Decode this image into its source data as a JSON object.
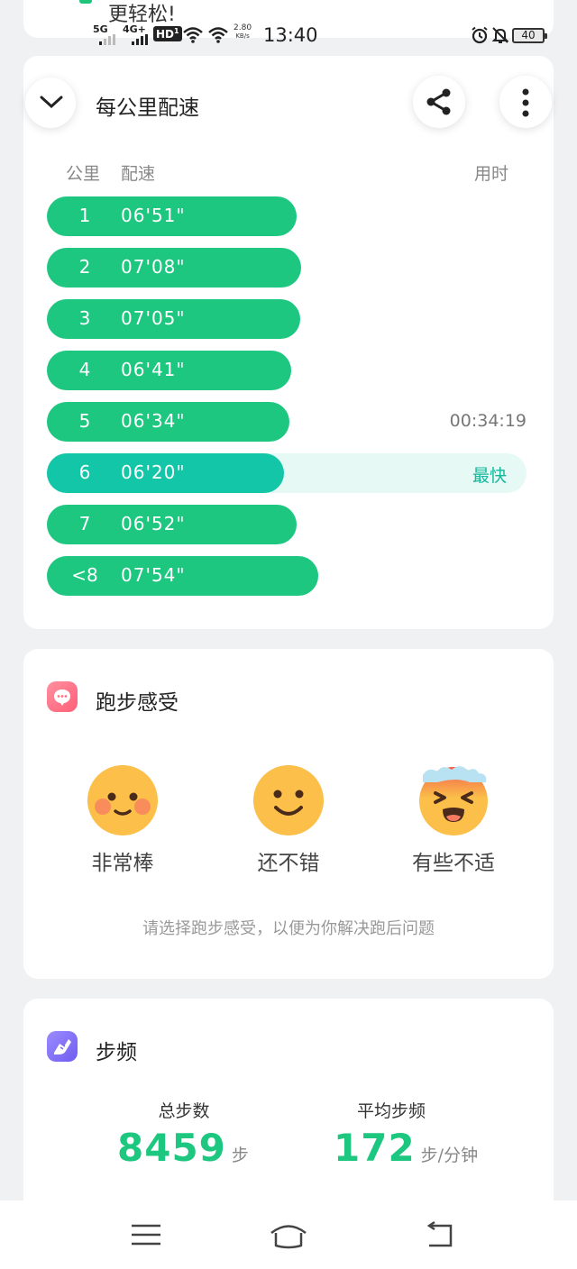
{
  "peek": {
    "text": "更轻松!"
  },
  "status_bar": {
    "net1": "5G",
    "net2": "4G+",
    "hd": "HD",
    "hd_sub": "1",
    "speed_value": "2.80",
    "speed_unit": "KB/s",
    "time": "13:40",
    "battery": "40"
  },
  "pace_card": {
    "title": "每公里配速",
    "col_km": "公里",
    "col_pace": "配速",
    "col_time": "用时",
    "rows": [
      {
        "km": "1",
        "pace": "06'51\"",
        "ratio": 0.52
      },
      {
        "km": "2",
        "pace": "07'08\"",
        "ratio": 0.53
      },
      {
        "km": "3",
        "pace": "07'05\"",
        "ratio": 0.528
      },
      {
        "km": "4",
        "pace": "06'41\"",
        "ratio": 0.51
      },
      {
        "km": "5",
        "pace": "06'34\"",
        "ratio": 0.505,
        "time": "00:34:19"
      },
      {
        "km": "6",
        "pace": "06'20\"",
        "ratio": 0.495,
        "tag": "最快"
      },
      {
        "km": "7",
        "pace": "06'52\"",
        "ratio": 0.52
      },
      {
        "km": "<8",
        "pace": "07'54\"",
        "ratio": 0.565
      }
    ]
  },
  "feel_card": {
    "title": "跑步感受",
    "options": [
      {
        "label": "非常棒",
        "icon": "blushing-smile-icon"
      },
      {
        "label": "还不错",
        "icon": "smile-icon"
      },
      {
        "label": "有些不适",
        "icon": "overheated-face-icon"
      }
    ],
    "hint": "请选择跑步感受，以便为你解决跑后问题"
  },
  "cadence_card": {
    "title": "步频",
    "total_steps": {
      "label": "总步数",
      "value": "8459",
      "unit": "步"
    },
    "avg_cadence": {
      "label": "平均步频",
      "value": "172",
      "unit": "步/分钟"
    }
  },
  "colors": {
    "accent": "#1ec77f",
    "fastest": "#14c6a8",
    "background": "#f0f1f3"
  }
}
